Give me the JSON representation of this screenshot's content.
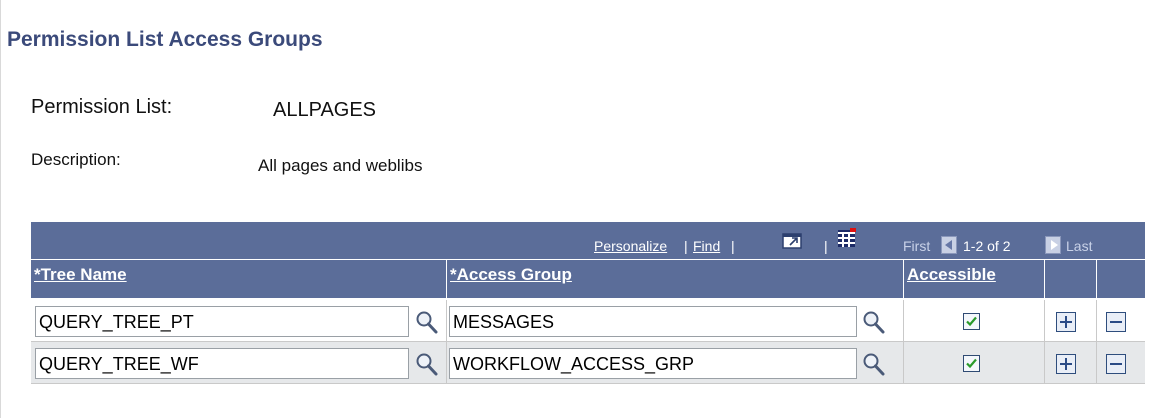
{
  "page": {
    "title": "Permission List Access Groups",
    "permission_list_label": "Permission List:",
    "permission_list_value": "ALLPAGES",
    "description_label": "Description:",
    "description_value": "All pages and weblibs"
  },
  "grid": {
    "toolbar": {
      "personalize": "Personalize",
      "sep1": "|",
      "find": "Find",
      "sep2": "|",
      "sep3": "|",
      "first": "First",
      "range": "1-2 of 2",
      "last": "Last",
      "icons": [
        "view-all-icon",
        "download-spreadsheet-icon",
        "previous-arrow-icon",
        "next-arrow-icon"
      ]
    },
    "columns": [
      "*Tree Name",
      "*Access Group",
      "Accessible"
    ],
    "rows": [
      {
        "tree_name": "QUERY_TREE_PT",
        "access_group": "MESSAGES",
        "accessible": true
      },
      {
        "tree_name": "QUERY_TREE_WF",
        "access_group": "WORKFLOW_ACCESS_GRP",
        "accessible": true
      }
    ]
  },
  "colors": {
    "header_bg": "#5b6d99",
    "title_color": "#3b4a7a",
    "alt_row_bg": "#e6e8ea",
    "check_color": "#2a9a2a"
  }
}
